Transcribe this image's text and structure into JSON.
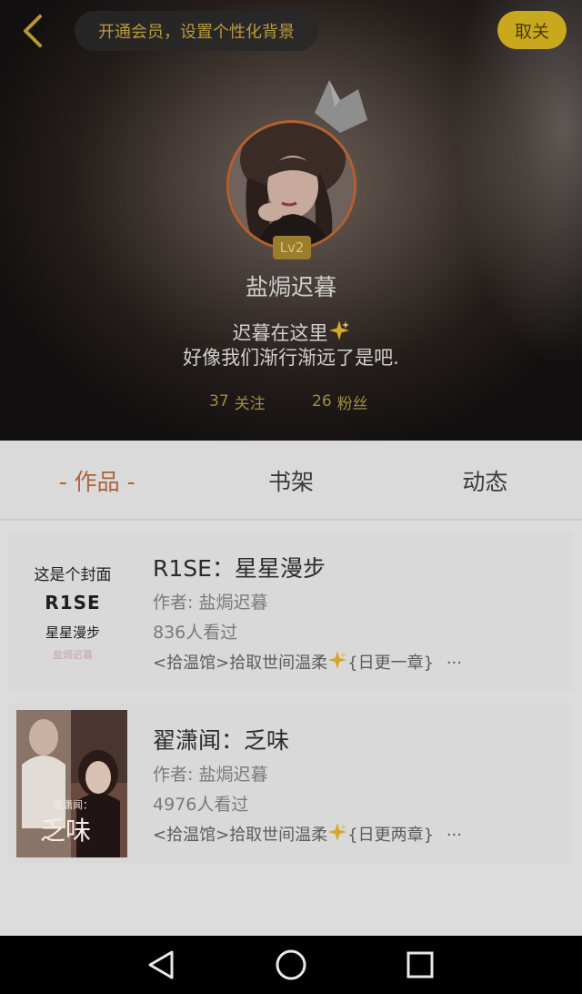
{
  "header": {
    "vip_banner": "开通会员，设置个性化背景",
    "follow_button": "取关",
    "level": "Lv2",
    "nickname": "盐焗迟暮",
    "bio_line1": "迟暮在这里",
    "bio_line2": "好像我们渐行渐远了是吧.",
    "following_count": "37",
    "following_label": "关注",
    "fans_count": "26",
    "fans_label": "粉丝"
  },
  "tabs": [
    {
      "label": "- 作品 -",
      "active": true
    },
    {
      "label": "书架",
      "active": false
    },
    {
      "label": "动态",
      "active": false
    }
  ],
  "works": [
    {
      "cover_lines": [
        "这是个封面",
        "R1SE",
        "星星漫步",
        "盐焗迟暮"
      ],
      "title": "R1SE：星星漫步",
      "author": "作者: 盐焗迟暮",
      "views": "836人看过",
      "desc_prefix": "<拾温馆>拾取世间温柔",
      "desc_suffix": "{日更一章}",
      "more": "···"
    },
    {
      "cover_lines": [
        "翟潇闻：",
        "乏味"
      ],
      "title": "翟潇闻：乏味",
      "author": "作者: 盐焗迟暮",
      "views": "4976人看过",
      "desc_prefix": "<拾温馆>拾取世间温柔",
      "desc_suffix": "{日更两章}",
      "more": "···"
    }
  ],
  "colors": {
    "accent_gold": "#c9a81d",
    "tab_active": "#b0603a",
    "avatar_ring": "#b5602c",
    "stat_text": "#a08c44"
  },
  "icons": {
    "back": "chevron-left-icon",
    "crown": "crown-icon",
    "sparkle": "sparkle-icon",
    "nav_back": "triangle-back-icon",
    "nav_home": "circle-home-icon",
    "nav_recent": "square-recent-icon"
  }
}
